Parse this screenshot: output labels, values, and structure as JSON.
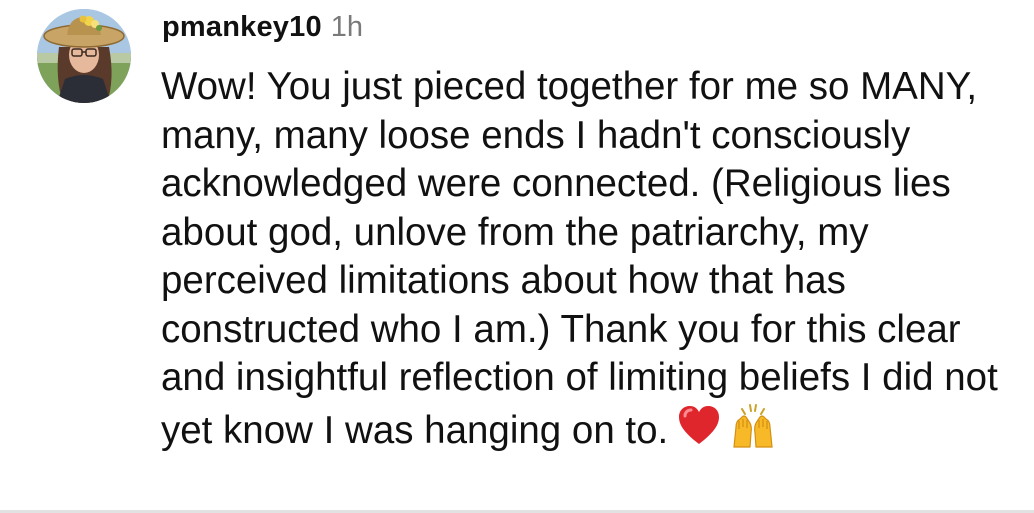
{
  "comment": {
    "username": "pmankey10",
    "timestamp": "1h",
    "text": "Wow! You just pieced together for me so MANY, many, many loose ends I hadn't consciously acknowledged were connected. (Religious lies about god, unlove from the patriarchy, my perceived limitations about how that has constructed who I am.) Thank you for this clear and insightful reflection of limiting beliefs I did not yet know I was hanging on to.",
    "emojis": [
      "red-heart-icon",
      "raising-hands-icon"
    ]
  },
  "colors": {
    "text": "#111111",
    "timestamp": "#7a7a7a",
    "heart": "#e0262d",
    "hands": "#f7b928",
    "divider": "#e2e2e2"
  }
}
